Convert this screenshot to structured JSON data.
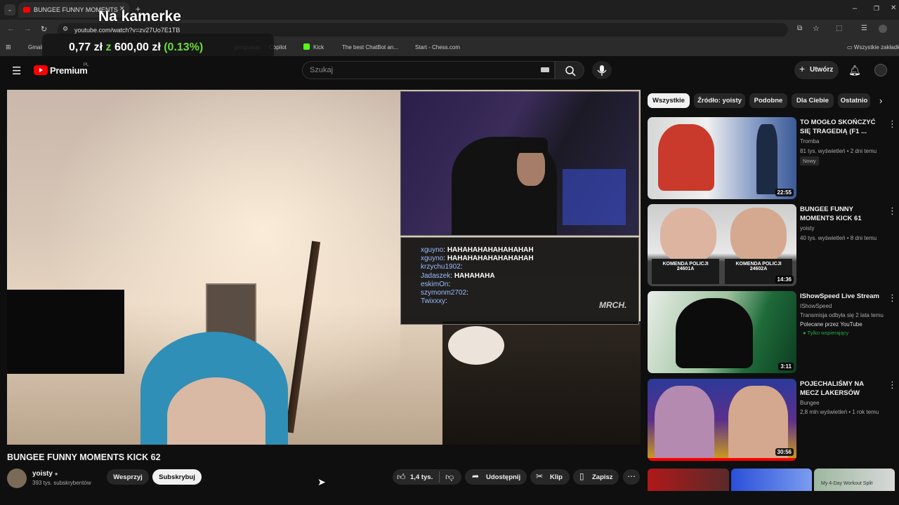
{
  "browser": {
    "tab_title": "BUNGEE FUNNY MOMENTS",
    "url": "youtube.com/watch?v=zv27Uo7E1TB",
    "bookmarks": [
      "Gmail",
      "geoguessr",
      "Copilot",
      "Kick",
      "The best ChatBot an...",
      "Start - Chess.com"
    ],
    "bookmarks_folder": "Wszystkie zakładki"
  },
  "overlay": {
    "title": "Na kamerke",
    "amount_small": "0,77 zł",
    "connector": "z",
    "amount_total": "600,00 zł",
    "percent": "(0.13%)"
  },
  "youtube": {
    "logo": "Premium",
    "region": "PL",
    "search_placeholder": "Szukaj",
    "create_label": "Utwórz"
  },
  "stream_chat": [
    {
      "user": "xguyno",
      "msg": "HAHAHAHAHAHAHAHAH"
    },
    {
      "user": "xguyno",
      "msg": "HAHAHAHAHAHAHAHAH"
    },
    {
      "user": "krzychu1902",
      "msg": ""
    },
    {
      "user": "Jadaszek",
      "msg": "HAHAHAHA"
    },
    {
      "user": "eskimOn",
      "msg": ""
    },
    {
      "user": "szymonm2702",
      "msg": ""
    },
    {
      "user": "Twixxxy",
      "msg": ""
    }
  ],
  "stream_brand": "MRCH.",
  "video": {
    "title": "BUNGEE FUNNY MOMENTS KICK 62",
    "channel": "yoisty",
    "subscribers": "393 tys. subskrybentów",
    "support_label": "Wesprzyj",
    "subscribe_label": "Subskrybuj",
    "likes": "1,4 tys.",
    "share_label": "Udostępnij",
    "clip_label": "Klip",
    "save_label": "Zapisz"
  },
  "chips": [
    "Wszystkie",
    "Źródło: yoisty",
    "Podobne",
    "Dla Ciebie",
    "Ostatnio"
  ],
  "recommendations": [
    {
      "title": "TO MOGŁO SKOŃCZYĆ SIĘ TRAGEDIĄ (F1 ...",
      "channel": "Tromba",
      "meta": "81 tys. wyświetleń • 2 dni temu",
      "badge": "Nowy",
      "duration": "22:55"
    },
    {
      "title": "BUNGEE FUNNY MOMENTS KICK 61",
      "channel": "yoisty",
      "meta": "40 tys. wyświetleń • 8 dni temu",
      "badge": "",
      "duration": "14:36"
    },
    {
      "title": "IShowSpeed Live Stream",
      "channel": "IShowSpeed",
      "meta": "Transmisja odbyła się 2 lata temu",
      "extra": "Polecane przez YouTube",
      "badge": "Tylko wspierający",
      "duration": "3:11"
    },
    {
      "title": "POJECHALIŚMY NA MECZ LAKERSÓW",
      "channel": "Bungee",
      "meta": "2,8 mln wyświetleń • 1 rok temu",
      "badge": "",
      "duration": "30:56"
    }
  ],
  "thumb_text": {
    "police_1": "KOMENDA POLICJI",
    "police_2": "KOMENDA POLICJI",
    "id_1": "24601A",
    "id_2": "24602A",
    "bottom_right": "My 4-Day Workout Split"
  },
  "colors": {
    "accent_red": "#ff0000",
    "money_green": "#6bdc3a",
    "bg": "#0f0f0f"
  }
}
